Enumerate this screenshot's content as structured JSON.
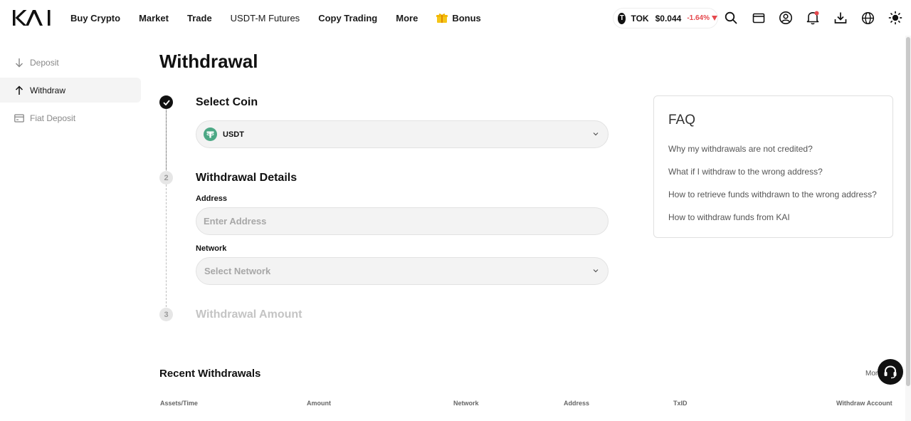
{
  "header": {
    "logo_text": "KAI",
    "nav": [
      "Buy Crypto",
      "Market",
      "Trade",
      "USDT-M Futures",
      "Copy Trading",
      "More"
    ],
    "bonus_label": "Bonus",
    "ticker": {
      "symbol": "TOK",
      "price": "$0.044",
      "change": "-1.64%",
      "change_color": "#e5484d"
    },
    "icons": [
      "search-icon",
      "wallet-icon",
      "user-icon",
      "bell-icon",
      "download-icon",
      "globe-icon",
      "sun-icon"
    ]
  },
  "sidebar": {
    "items": [
      {
        "label": "Deposit",
        "icon": "arrow-down-icon",
        "active": false
      },
      {
        "label": "Withdraw",
        "icon": "arrow-up-icon",
        "active": true
      },
      {
        "label": "Fiat Deposit",
        "icon": "card-icon",
        "active": false
      }
    ]
  },
  "page": {
    "title": "Withdrawal"
  },
  "steps": {
    "step1": {
      "title": "Select Coin",
      "coin": "USDT",
      "status": "done"
    },
    "step2": {
      "number": "2",
      "title": "Withdrawal Details",
      "address_label": "Address",
      "address_placeholder": "Enter Address",
      "network_label": "Network",
      "network_placeholder": "Select Network"
    },
    "step3": {
      "number": "3",
      "title": "Withdrawal Amount"
    }
  },
  "faq": {
    "title": "FAQ",
    "links": [
      "Why my withdrawals are not credited?",
      "What if I withdraw to the wrong address?",
      "How to retrieve funds withdrawn to the wrong address?",
      "How to withdraw funds from KAI"
    ]
  },
  "recent": {
    "title": "Recent Withdrawals",
    "more_label": "More",
    "columns": [
      "Assets/Time",
      "Amount",
      "Network",
      "Address",
      "TxID",
      "Withdraw Account"
    ]
  },
  "colors": {
    "accent_dark": "#111111",
    "usdt_green": "#4ca885",
    "negative": "#e5484d"
  }
}
